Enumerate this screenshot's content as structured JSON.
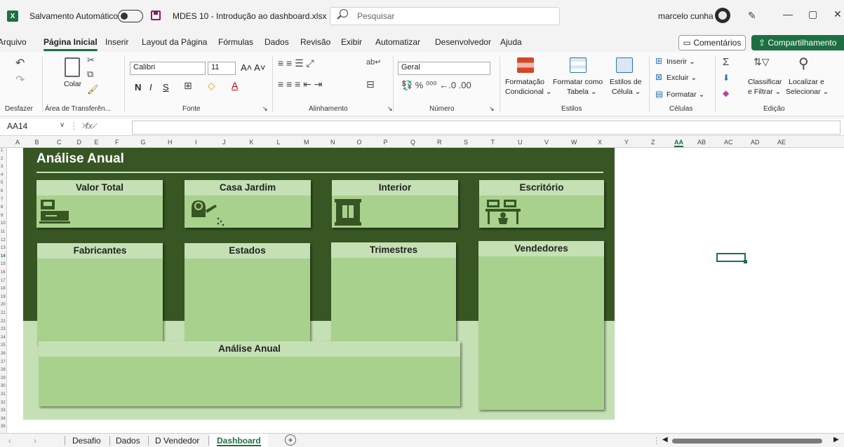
{
  "titlebar": {
    "app_icon": "X",
    "autosave_label": "Salvamento Automático",
    "filename": "MDES 10 - Introdução ao dashboard.xlsx ∨",
    "search_placeholder": "Pesquisar",
    "username": "marcelo cunha",
    "minimize": "—",
    "restore": "▢",
    "close": "✕"
  },
  "menu": {
    "tabs": [
      "Arquivo",
      "Página Inicial",
      "Inserir",
      "Layout da Página",
      "Fórmulas",
      "Dados",
      "Revisão",
      "Exibir",
      "Automatizar",
      "Desenvolvedor",
      "Ajuda"
    ],
    "comments": "Comentários",
    "share": "Compartilhamento"
  },
  "ribbon": {
    "undo_group": "Desfazer",
    "clipboard_group": "Área de Transferên...",
    "paste": "Colar",
    "font_group": "Fonte",
    "font_name": "Calibri",
    "font_size": "11",
    "bold": "N",
    "italic": "I",
    "underline": "S",
    "alignment_group": "Alinhamento",
    "number_group": "Número",
    "number_format": "Geral",
    "styles_group": "Estilos",
    "conditional_format": [
      "Formatação",
      "Condicional ⌄"
    ],
    "format_table": [
      "Formatar como",
      "Tabela ⌄"
    ],
    "cell_styles": [
      "Estilos de",
      "Célula ⌄"
    ],
    "cells_group": "Células",
    "insert": "Inserir ⌄",
    "delete": "Excluir ⌄",
    "format": "Formatar ⌄",
    "editing_group": "Edição",
    "sort_filter": [
      "Classificar",
      "e Filtrar ⌄"
    ],
    "find_select": [
      "Localizar e",
      "Selecionar ⌄"
    ]
  },
  "formula_bar": {
    "name_box": "AA14",
    "fx": "fx",
    "formula": ""
  },
  "columns": [
    "A",
    "B",
    "C",
    "D",
    "E",
    "F",
    "G",
    "H",
    "I",
    "J",
    "K",
    "L",
    "M",
    "N",
    "O",
    "P",
    "Q",
    "R",
    "S",
    "T",
    "U",
    "V",
    "W",
    "X",
    "Y",
    "Z",
    "AA",
    "AB",
    "AC",
    "AD",
    "AE"
  ],
  "rows": [
    "1",
    "2",
    "3",
    "4",
    "5",
    "6",
    "7",
    "8",
    "9",
    "10",
    "11",
    "12",
    "13",
    "14",
    "15",
    "16",
    "17",
    "18",
    "19",
    "20",
    "21",
    "22",
    "23",
    "24",
    "25",
    "26",
    "27",
    "28",
    "29",
    "30",
    "31",
    "32",
    "33",
    "34",
    "35"
  ],
  "dashboard": {
    "title": "Análise Anual",
    "kpi_cards": [
      {
        "title": "Valor Total",
        "icon": "cash-register-icon"
      },
      {
        "title": "Casa Jardim",
        "icon": "watering-can-icon"
      },
      {
        "title": "Interior",
        "icon": "window-icon"
      },
      {
        "title": "Escritório",
        "icon": "office-desk-icon"
      }
    ],
    "panels": [
      "Fabricantes",
      "Estados",
      "Trimestres",
      "Vendedores"
    ],
    "annual_panel": "Análise Anual"
  },
  "sheets": {
    "tabs": [
      "Desafio",
      "Dados",
      "D Vendedor",
      "Dashboard"
    ],
    "active": "Dashboard",
    "add": "+"
  },
  "colors": {
    "excel_green": "#1d6f42",
    "dash_dark": "#375623",
    "dash_light": "#c5e0b4",
    "card_fill": "#a9d18e"
  }
}
